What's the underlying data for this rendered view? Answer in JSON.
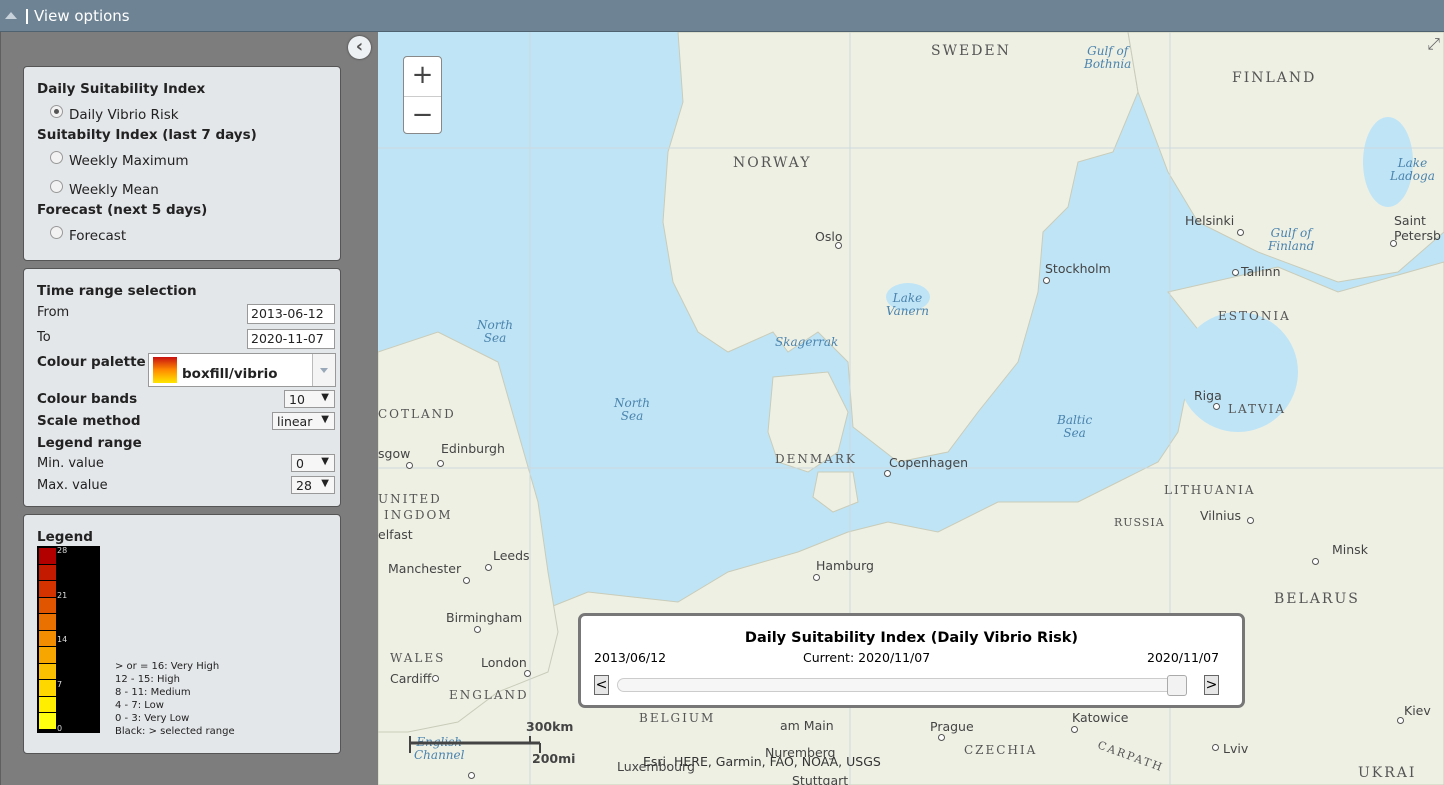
{
  "header": {
    "title": "View options"
  },
  "sidebar": {
    "suitability": {
      "heading_daily": "Daily Suitability Index",
      "option_daily": "Daily Vibrio Risk",
      "heading_weekly": "Suitabilty Index (last 7 days)",
      "option_weekly_max": "Weekly Maximum",
      "option_weekly_mean": "Weekly Mean",
      "heading_forecast": "Forecast (next 5 days)",
      "option_forecast": "Forecast",
      "selected": "Daily Vibrio Risk"
    },
    "time_range": {
      "heading": "Time range selection",
      "from_label": "From",
      "from_value": "2013-06-12",
      "to_label": "To",
      "to_value": "2020-11-07",
      "palette_label": "Colour palette",
      "palette_value": "boxfill/vibrio",
      "bands_label": "Colour bands",
      "bands_value": "10",
      "scale_label": "Scale method",
      "scale_value": "linear",
      "legend_range_label": "Legend range",
      "min_label": "Min. value",
      "min_value": "0",
      "max_label": "Max. value",
      "max_value": "28"
    },
    "legend": {
      "heading": "Legend",
      "ticks": [
        "28",
        "21",
        "14",
        "7",
        "0"
      ],
      "colors": [
        "#b20000",
        "#c41a00",
        "#d43300",
        "#e05500",
        "#ea7000",
        "#f28c00",
        "#f7a600",
        "#fbc000",
        "#ffd700",
        "#ffee00",
        "#ffff10"
      ],
      "classes": [
        "> or = 16: Very High",
        "12 - 15: High",
        "8 - 11: Medium",
        "4 - 7: Low",
        "0 - 3: Very Low",
        "Black: > selected range"
      ]
    }
  },
  "map": {
    "zoom_in": "+",
    "zoom_out": "−",
    "labels": {
      "sweden": "SWEDEN",
      "finland": "FINLAND",
      "norway": "NORWAY",
      "estonia": "ESTONIA",
      "latvia": "LATVIA",
      "lithuania": "LITHUANIA",
      "russia": "RUSSIA",
      "belarus": "BELARUS",
      "denmark": "DENMARK",
      "scotland": "COTLAND",
      "united": "UNITED",
      "kingdom": "INGDOM",
      "wales": "WALES",
      "england": "ENGLAND",
      "belgium": "BELGIUM",
      "czechia": "CZECHIA",
      "ukraine": "UKRAI",
      "carpath": "CARPATH"
    },
    "waters": {
      "gulf_bothnia": "Gulf of\nBothnia",
      "lake_ladoga": "Lake\nLadoga",
      "gulf_finland": "Gulf of\nFinland",
      "lake_vanern": "Lake\nVanern",
      "skagerrak": "Skagerrak",
      "north_sea_1": "North\nSea",
      "north_sea_2": "North\nSea",
      "baltic_sea": "Baltic\nSea",
      "english_channel": "English\nChannel"
    },
    "cities": {
      "oslo": "Oslo",
      "stockholm": "Stockholm",
      "helsinki": "Helsinki",
      "saint_peter": "Saint\nPetersb",
      "tallinn": "Tallinn",
      "riga": "Riga",
      "vilnius": "Vilnius",
      "minsk": "Minsk",
      "copenhagen": "Copenhagen",
      "hamburg": "Hamburg",
      "edinburgh": "Edinburgh",
      "glasgow": "sgow",
      "belfast": "elfast",
      "leeds": "Leeds",
      "manchester": "Manchester",
      "birmingham": "Birmingham",
      "london": "London",
      "cardiff": "Cardiff",
      "frankfurt": "am Main",
      "prague": "Prague",
      "katowice": "Katowice",
      "kiev": "Kiev",
      "lviv": "Lviv",
      "nuremberg": "Nuremberg",
      "luxembourg": "Luxembourg",
      "stuttgart": "Stuttgart"
    },
    "scale_km": "300km",
    "scale_mi": "200mi",
    "attribution": "Esri, HERE, Garmin, FAO, NOAA, USGS"
  },
  "time_slider": {
    "title": "Daily Suitability Index (Daily Vibrio Risk)",
    "start": "2013/06/12",
    "current": "Current: 2020/11/07",
    "end": "2020/11/07",
    "prev": "<",
    "next": ">",
    "position": 1.0
  }
}
